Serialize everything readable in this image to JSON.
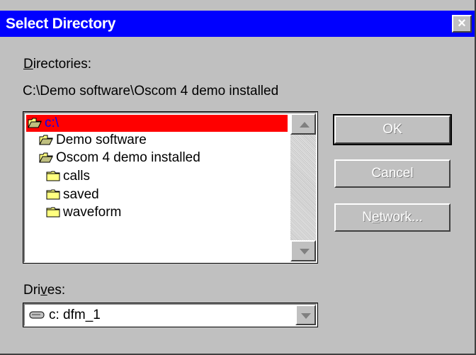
{
  "window": {
    "title": "Select Directory",
    "close_label": "×"
  },
  "directories": {
    "label_pre": "",
    "label_key": "D",
    "label_post": "irectories:",
    "current_path": "C:\\Demo software\\Oscom 4 demo installed",
    "items": [
      {
        "label": "c:\\",
        "icon": "open-folder-icon",
        "selected": true
      },
      {
        "label": "Demo software",
        "icon": "open-folder-icon",
        "selected": false
      },
      {
        "label": "Oscom 4 demo installed",
        "icon": "open-folder-icon",
        "selected": false
      },
      {
        "label": "calls",
        "icon": "folder-icon",
        "selected": false
      },
      {
        "label": "saved",
        "icon": "folder-icon",
        "selected": false
      },
      {
        "label": "waveform",
        "icon": "folder-icon",
        "selected": false
      }
    ]
  },
  "buttons": {
    "ok": "OK",
    "cancel": "Cancel",
    "network_pre": "N",
    "network_key": "e",
    "network_post": "twork..."
  },
  "drives": {
    "label_pre": "Dri",
    "label_key": "v",
    "label_post": "es:",
    "selected": "c: dfm_1"
  },
  "colors": {
    "titlebar": "#0000ff",
    "selection": "#ff0000",
    "face": "#c0c0c0"
  }
}
